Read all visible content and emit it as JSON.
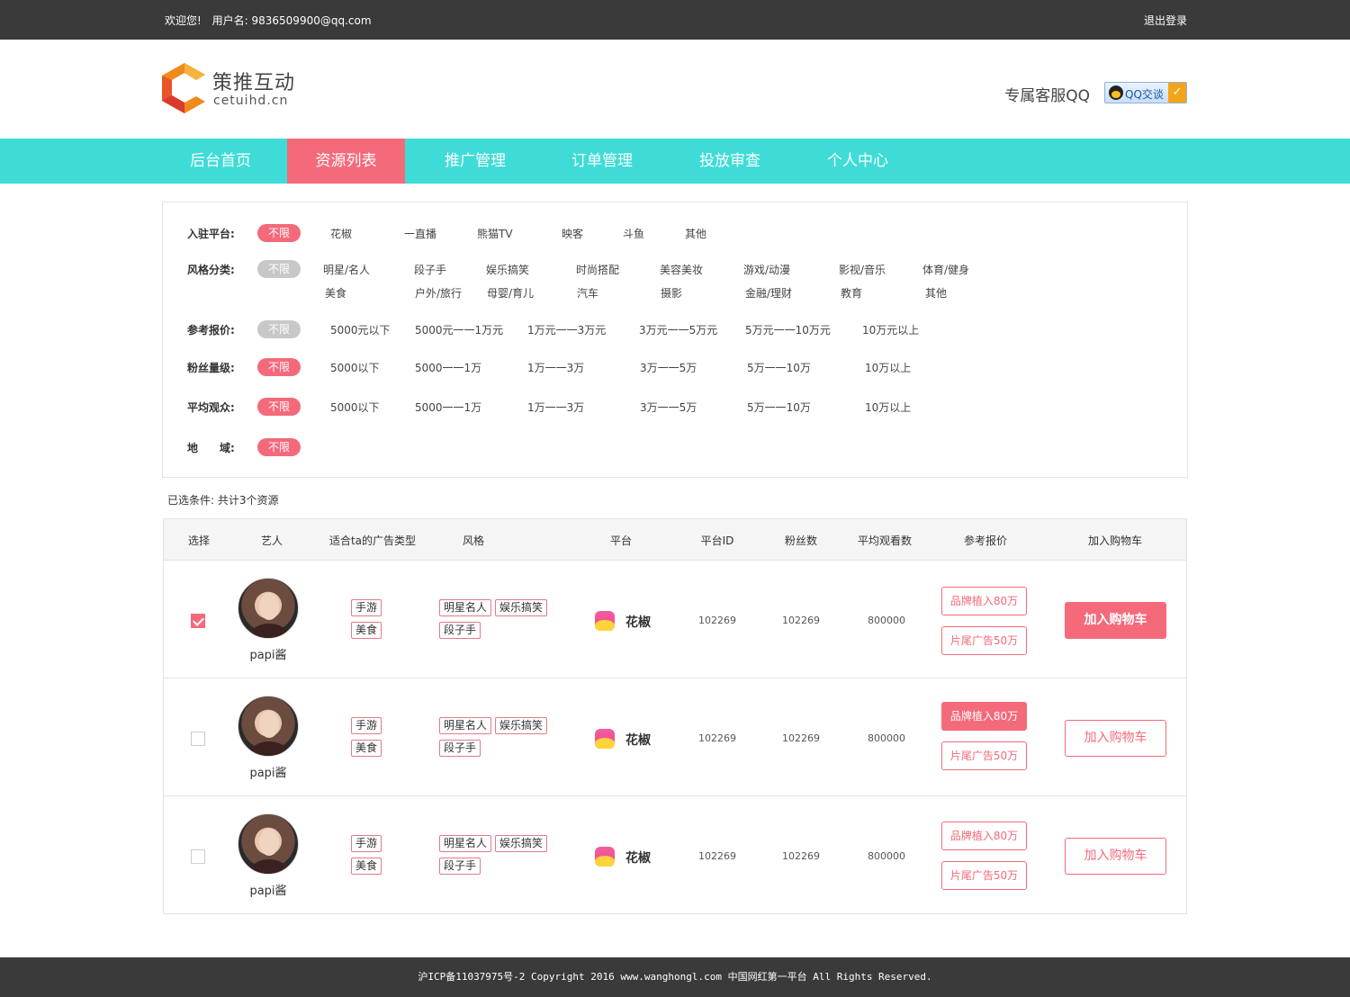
{
  "topbar": {
    "welcome": "欢迎您!",
    "username": "用户名: 9836509900@qq.com",
    "logout": "退出登录"
  },
  "header": {
    "logo_cn": "策推互动",
    "logo_en": "cetuihd.cn",
    "service_label": "专属客服QQ",
    "qq_button": "QQ交谈"
  },
  "nav": {
    "items": [
      "后台首页",
      "资源列表",
      "推广管理",
      "订单管理",
      "投放审查",
      "个人中心"
    ],
    "active_index": 1
  },
  "filters": {
    "platform": {
      "label": "入驻平台:",
      "all": "不限",
      "options": [
        "花椒",
        "一直播",
        "熊猫TV",
        "映客",
        "斗鱼",
        "其他"
      ]
    },
    "style": {
      "label": "风格分类:",
      "all": "不限",
      "options": [
        "明星/名人",
        "段子手",
        "娱乐搞笑",
        "时尚搭配",
        "美容美妆",
        "游戏/动漫",
        "影视/音乐",
        "体育/健身",
        "美食",
        "户外/旅行",
        "母婴/育儿",
        "汽车",
        "摄影",
        "金融/理财",
        "教育",
        "其他"
      ]
    },
    "price": {
      "label": "参考报价:",
      "all": "不限",
      "options": [
        "5000元以下",
        "5000元一一1万元",
        "1万元一一3万元",
        "3万元一一5万元",
        "5万元一一10万元",
        "10万元以上"
      ]
    },
    "fans": {
      "label": "粉丝量级:",
      "all": "不限",
      "options": [
        "5000以下",
        "5000一一1万",
        "1万一一3万",
        "3万一一5万",
        "5万一一10万",
        "10万以上"
      ]
    },
    "viewers": {
      "label": "平均观众:",
      "all": "不限",
      "options": [
        "5000以下",
        "5000一一1万",
        "1万一一3万",
        "3万一一5万",
        "5万一一10万",
        "10万以上"
      ]
    },
    "region": {
      "label": "地　　域:",
      "all": "不限"
    }
  },
  "selected_conditions": "已选条件: 共计3个资源",
  "table": {
    "headers": [
      "选择",
      "艺人",
      "适合ta的广告类型",
      "风格",
      "平台",
      "平台ID",
      "粉丝数",
      "平均观看数",
      "参考报价",
      "加入购物车"
    ],
    "rows": [
      {
        "checked": true,
        "name": "papi酱",
        "ad_types": [
          "手游",
          "美食"
        ],
        "styles": [
          "明星名人",
          "娱乐搞笑",
          "段子手"
        ],
        "platform": "花椒",
        "platform_id": "102269",
        "fans": "102269",
        "avg_views": "800000",
        "price1": "品牌植入80万",
        "price2": "片尾广告50万",
        "cart": "加入购物车"
      },
      {
        "checked": false,
        "name": "papi酱",
        "ad_types": [
          "手游",
          "美食"
        ],
        "styles": [
          "明星名人",
          "娱乐搞笑",
          "段子手"
        ],
        "platform": "花椒",
        "platform_id": "102269",
        "fans": "102269",
        "avg_views": "800000",
        "price1": "品牌植入80万",
        "price2": "片尾广告50万",
        "cart": "加入购物车"
      },
      {
        "checked": false,
        "name": "papi酱",
        "ad_types": [
          "手游",
          "美食"
        ],
        "styles": [
          "明星名人",
          "娱乐搞笑",
          "段子手"
        ],
        "platform": "花椒",
        "platform_id": "102269",
        "fans": "102269",
        "avg_views": "800000",
        "price1": "品牌植入80万",
        "price2": "片尾广告50万",
        "cart": "加入购物车"
      }
    ]
  },
  "footer": "沪ICP备11037975号-2 Copyright 2016 www.wanghongl.com 中国网红第一平台 All Rights Reserved.",
  "colors": {
    "accent": "#f46a7b",
    "nav": "#3fdcd7",
    "dark": "#3a3a3a"
  }
}
